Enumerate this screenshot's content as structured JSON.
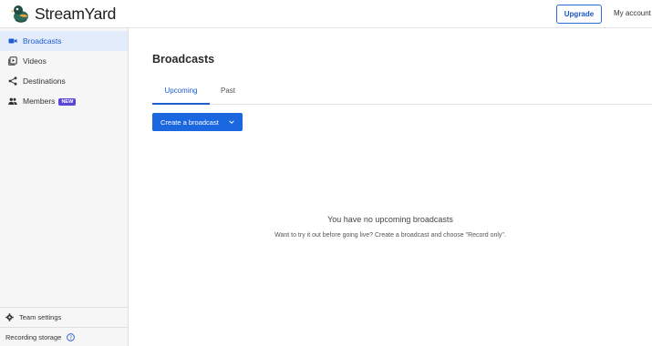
{
  "header": {
    "logo_text": "StreamYard",
    "upgrade_label": "Upgrade",
    "account_label": "My account"
  },
  "sidebar": {
    "items": [
      {
        "label": "Broadcasts",
        "icon": "video-camera-icon",
        "active": true
      },
      {
        "label": "Videos",
        "icon": "video-library-icon",
        "active": false
      },
      {
        "label": "Destinations",
        "icon": "share-icon",
        "active": false
      },
      {
        "label": "Members",
        "icon": "people-icon",
        "active": false,
        "badge": "NEW"
      }
    ],
    "team_settings_label": "Team settings",
    "recording_storage_label": "Recording storage"
  },
  "main": {
    "title": "Broadcasts",
    "tabs": [
      {
        "label": "Upcoming",
        "active": true
      },
      {
        "label": "Past",
        "active": false
      }
    ],
    "create_button_label": "Create a broadcast",
    "empty_state": {
      "title": "You have no upcoming broadcasts",
      "subtitle": "Want to try it out before going live? Create a broadcast and choose \"Record only\"."
    }
  },
  "colors": {
    "accent": "#1a67e0",
    "active_bg": "#e3ecfb",
    "badge": "#5b47d6"
  }
}
